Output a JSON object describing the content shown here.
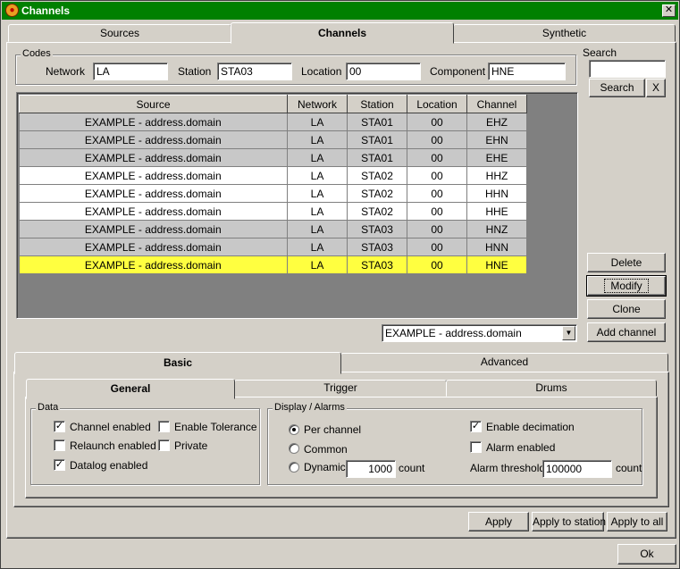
{
  "window": {
    "title": "Channels",
    "close": "✕"
  },
  "top_tabs": [
    "Sources",
    "Channels",
    "Synthetic"
  ],
  "codes": {
    "legend": "Codes",
    "network_label": "Network",
    "network_value": "LA",
    "station_label": "Station",
    "station_value": "STA03",
    "location_label": "Location",
    "location_value": "00",
    "component_label": "Component",
    "component_value": "HNE"
  },
  "search": {
    "label": "Search",
    "value": "",
    "button": "Search",
    "clear": "X"
  },
  "table": {
    "headers": [
      "Source",
      "Network",
      "Station",
      "Location",
      "Channel"
    ],
    "rows": [
      [
        "EXAMPLE - address.domain",
        "LA",
        "STA01",
        "00",
        "EHZ"
      ],
      [
        "EXAMPLE - address.domain",
        "LA",
        "STA01",
        "00",
        "EHN"
      ],
      [
        "EXAMPLE - address.domain",
        "LA",
        "STA01",
        "00",
        "EHE"
      ],
      [
        "EXAMPLE - address.domain",
        "LA",
        "STA02",
        "00",
        "HHZ"
      ],
      [
        "EXAMPLE - address.domain",
        "LA",
        "STA02",
        "00",
        "HHN"
      ],
      [
        "EXAMPLE - address.domain",
        "LA",
        "STA02",
        "00",
        "HHE"
      ],
      [
        "EXAMPLE - address.domain",
        "LA",
        "STA03",
        "00",
        "HNZ"
      ],
      [
        "EXAMPLE - address.domain",
        "LA",
        "STA03",
        "00",
        "HNN"
      ],
      [
        "EXAMPLE - address.domain",
        "LA",
        "STA03",
        "00",
        "HNE"
      ]
    ],
    "row_styles": [
      "gray",
      "gray",
      "gray",
      "white",
      "white",
      "white",
      "gray",
      "gray",
      "yellow"
    ],
    "selected_color": "#ffff40"
  },
  "side_buttons": {
    "delete": "Delete",
    "modify": "Modify",
    "clone": "Clone",
    "add": "Add channel"
  },
  "source_select": {
    "value": "EXAMPLE - address.domain",
    "arrow": "▼"
  },
  "lower_tabs": [
    "Basic",
    "Advanced"
  ],
  "inner_tabs": [
    "General",
    "Trigger",
    "Drums"
  ],
  "data_group": {
    "legend": "Data",
    "channel_enabled": "Channel enabled",
    "enable_tolerance": "Enable Tolerance",
    "relaunch_enabled": "Relaunch enabled",
    "private": "Private",
    "datalog_enabled": "Datalog enabled",
    "check_mark": "✓"
  },
  "display_group": {
    "legend": "Display / Alarms",
    "per_channel": "Per channel",
    "common": "Common",
    "dynamic": "Dynamic",
    "dynamic_value": "1000",
    "count1": "count",
    "enable_decimation": "Enable decimation",
    "alarm_enabled": "Alarm enabled",
    "alarm_threshold_label": "Alarm threshold",
    "alarm_threshold_value": "100000",
    "count2": "count"
  },
  "bottom_buttons": {
    "apply": "Apply",
    "apply_station": "Apply to station",
    "apply_all": "Apply to all",
    "ok": "Ok"
  }
}
